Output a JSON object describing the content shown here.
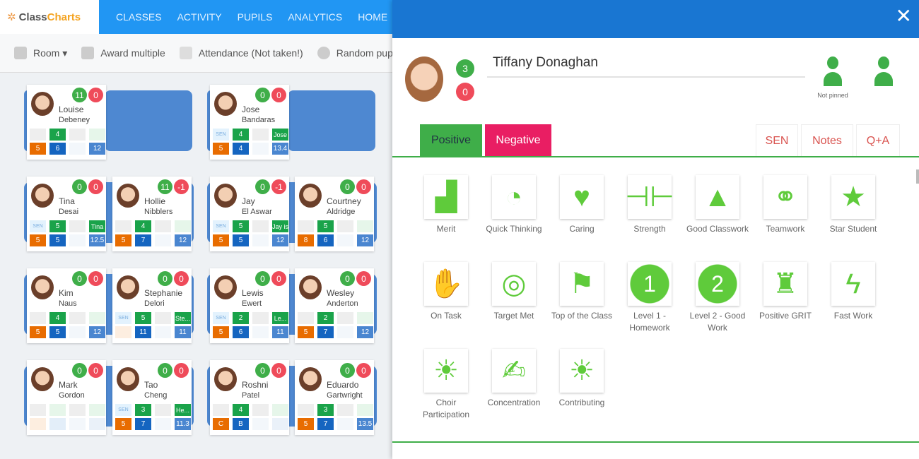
{
  "app": {
    "logo_part1": "Class",
    "logo_part2": "Charts"
  },
  "nav": [
    "CLASSES",
    "ACTIVITY",
    "PUPILS",
    "ANALYTICS",
    "HOME"
  ],
  "toolbar": {
    "room": "Room ▾",
    "award_multiple": "Award multiple",
    "attendance": "Attendance  (Not taken!)",
    "random": "Random pupil"
  },
  "colors": {
    "nav_blue": "#2196f3",
    "panel_header": "#1976d2",
    "positive": "#3fae49",
    "negative": "#e91e63",
    "desk": "#4e88d1",
    "icon_green": "#5fcb3b"
  },
  "rows": [
    [
      {
        "first": "Louise",
        "last": "Debeney",
        "pos": 11,
        "neg": 0,
        "cells": [
          "",
          "4",
          "",
          "",
          "5",
          "6",
          "",
          "12"
        ],
        "desk_placeholder": true
      },
      null,
      {
        "first": "Jose",
        "last": "Bandaras",
        "pos": 0,
        "neg": 0,
        "cells": [
          "SEN",
          "4",
          "",
          "Jose",
          "5",
          "4",
          "",
          "13.4"
        ],
        "desk_placeholder": true
      },
      null
    ],
    [
      {
        "first": "Tina",
        "last": "Desai",
        "pos": 0,
        "neg": 0,
        "cells": [
          "SEN",
          "5",
          "",
          "Tina",
          "5",
          "5",
          "",
          "12.5"
        ]
      },
      {
        "first": "Hollie",
        "last": "Nibblers",
        "pos": 11,
        "neg": -1,
        "cells": [
          "",
          "4",
          "",
          "",
          "5",
          "7",
          "",
          "12"
        ]
      },
      {
        "first": "Jay",
        "last": "El Aswar",
        "pos": 0,
        "neg": -1,
        "cells": [
          "SEN",
          "5",
          "",
          "Jay is",
          "5",
          "5",
          "",
          "12"
        ]
      },
      {
        "first": "Courtney",
        "last": "Aldridge",
        "pos": 0,
        "neg": 0,
        "cells": [
          "",
          "5",
          "",
          "",
          "8",
          "6",
          "",
          "12"
        ]
      }
    ],
    [
      {
        "first": "Kim",
        "last": "Naus",
        "pos": 0,
        "neg": 0,
        "cells": [
          "",
          "4",
          "",
          "",
          "5",
          "5",
          "",
          "12"
        ]
      },
      {
        "first": "Stephanie",
        "last": "Delori",
        "pos": 0,
        "neg": 0,
        "cells": [
          "SEN",
          "5",
          "",
          "Ste...",
          "",
          "11",
          "",
          "11"
        ]
      },
      {
        "first": "Lewis",
        "last": "Ewert",
        "pos": 0,
        "neg": 0,
        "cells": [
          "SEN",
          "2",
          "",
          "Le...",
          "5",
          "6",
          "",
          "11"
        ]
      },
      {
        "first": "Wesley",
        "last": "Anderton",
        "pos": 0,
        "neg": 0,
        "cells": [
          "",
          "2",
          "",
          "",
          "5",
          "7",
          "",
          "12"
        ]
      }
    ],
    [
      {
        "first": "Mark",
        "last": "Gordon",
        "pos": 0,
        "neg": 0,
        "cells": [
          "",
          "",
          "",
          "",
          "",
          "",
          "",
          ""
        ]
      },
      {
        "first": "Tao",
        "last": "Cheng",
        "pos": 0,
        "neg": 0,
        "cells": [
          "SEN",
          "3",
          "",
          "He...",
          "5",
          "7",
          "",
          "11.3"
        ]
      },
      {
        "first": "Roshni",
        "last": "Patel",
        "pos": 0,
        "neg": 0,
        "cells": [
          "",
          "4",
          "",
          "",
          "C",
          "B",
          "",
          ""
        ]
      },
      {
        "first": "Eduardo",
        "last": "Gartwright",
        "pos": 0,
        "neg": 0,
        "cells": [
          "",
          "3",
          "",
          "",
          "5",
          "7",
          "",
          "13.5"
        ]
      }
    ]
  ],
  "panel": {
    "close": "✕",
    "student_name": "Tiffany Donaghan",
    "positive_points": "3",
    "negative_points": "0",
    "pin_status": "Not pinned",
    "tabs": {
      "positive": "Positive",
      "negative": "Negative",
      "sen": "SEN",
      "notes": "Notes",
      "qa": "Q+A"
    },
    "behaviours": [
      {
        "label": "Merit",
        "icon": "bar-chart-arrow-icon",
        "glyph": "▟"
      },
      {
        "label": "Quick Thinking",
        "icon": "head-clock-icon",
        "glyph": "◔"
      },
      {
        "label": "Caring",
        "icon": "heart-icon",
        "glyph": "♥"
      },
      {
        "label": "Strength",
        "icon": "dumbbell-icon",
        "glyph": "⊣⊢"
      },
      {
        "label": "Good Classwork",
        "icon": "rocket-icon",
        "glyph": "▲"
      },
      {
        "label": "Teamwork",
        "icon": "handshake-icon",
        "glyph": "⚭"
      },
      {
        "label": "Star Student",
        "icon": "star-icon",
        "glyph": "★"
      },
      {
        "label": "On Task",
        "icon": "thumbs-up-icon",
        "glyph": "✋"
      },
      {
        "label": "Target Met",
        "icon": "target-cursor-icon",
        "glyph": "◎"
      },
      {
        "label": "Top of the Class",
        "icon": "climber-icon",
        "glyph": "⚑"
      },
      {
        "label": "Level 1 - Homework",
        "icon": "number-1-icon",
        "glyph": "1"
      },
      {
        "label": "Level 2 - Good Work",
        "icon": "number-2-icon",
        "glyph": "2"
      },
      {
        "label": "Positive GRIT",
        "icon": "trophy-podium-icon",
        "glyph": "♜"
      },
      {
        "label": "Fast Work",
        "icon": "lightning-icon",
        "glyph": "ϟ"
      },
      {
        "label": "Choir Participation",
        "icon": "lightbulb-icon",
        "glyph": "☀"
      },
      {
        "label": "Concentration",
        "icon": "person-at-desk-icon",
        "glyph": "✍"
      },
      {
        "label": "Contributing",
        "icon": "lightbulb-icon",
        "glyph": "☀"
      }
    ]
  }
}
